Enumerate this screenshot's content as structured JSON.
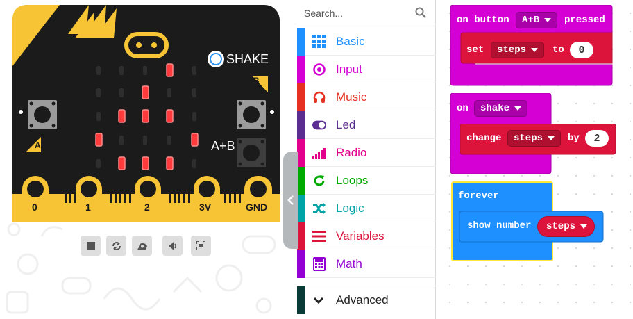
{
  "simulator": {
    "shake_label": "SHAKE",
    "button_a_label": "A",
    "button_b_label": "B",
    "button_ab_label": "A+B",
    "pins": [
      "0",
      "1",
      "2",
      "3V",
      "GND"
    ],
    "led_grid": [
      [
        0,
        0,
        0,
        1,
        0
      ],
      [
        0,
        0,
        1,
        0,
        0
      ],
      [
        0,
        1,
        1,
        1,
        0
      ],
      [
        1,
        0,
        0,
        0,
        1
      ],
      [
        0,
        1,
        1,
        1,
        0
      ]
    ],
    "toolbar": [
      "stop-icon",
      "restart-icon",
      "slow-motion-icon",
      "mute-icon",
      "fullscreen-icon"
    ]
  },
  "toolbox": {
    "search_placeholder": "Search...",
    "categories": [
      {
        "label": "Basic",
        "color": "#1e90ff",
        "icon": "grid-icon"
      },
      {
        "label": "Input",
        "color": "#d400d4",
        "icon": "target-icon"
      },
      {
        "label": "Music",
        "color": "#e63022",
        "icon": "headphones-icon"
      },
      {
        "label": "Led",
        "color": "#5c2d91",
        "icon": "toggle-icon"
      },
      {
        "label": "Radio",
        "color": "#e3008c",
        "icon": "signal-icon"
      },
      {
        "label": "Loops",
        "color": "#00aa00",
        "icon": "refresh-icon"
      },
      {
        "label": "Logic",
        "color": "#00a4a6",
        "icon": "shuffle-icon"
      },
      {
        "label": "Variables",
        "color": "#dc143c",
        "icon": "list-icon"
      },
      {
        "label": "Math",
        "color": "#9400d3",
        "icon": "calculator-icon"
      }
    ],
    "advanced_label": "Advanced"
  },
  "workspace": {
    "block1": {
      "prefix": "on button",
      "button": "A+B",
      "suffix": "pressed",
      "set": "set",
      "var": "steps",
      "to": "to",
      "value": "0"
    },
    "block2": {
      "prefix": "on",
      "event": "shake",
      "change": "change",
      "var": "steps",
      "by": "by",
      "value": "2"
    },
    "block3": {
      "forever": "forever",
      "show": "show number",
      "var": "steps"
    }
  },
  "colors": {
    "input_block": "#d400d4",
    "variable_block": "#dc143c",
    "basic_block": "#1e90ff",
    "highlight": "#ffe839",
    "board": "#1b1b1b",
    "board_accent": "#f7c435"
  }
}
